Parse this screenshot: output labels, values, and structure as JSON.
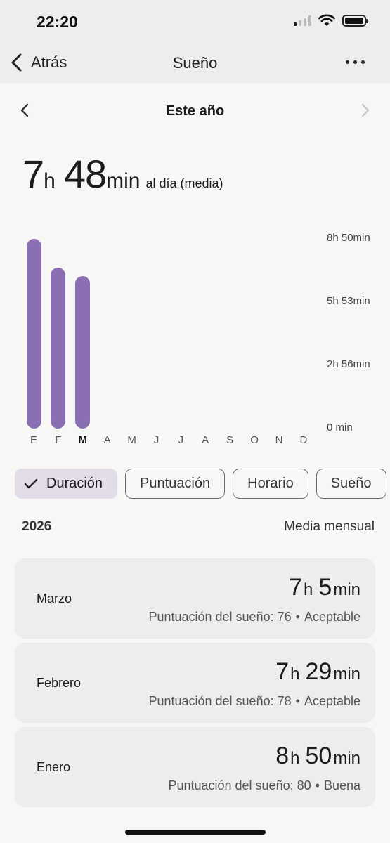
{
  "status_bar": {
    "time": "22:20"
  },
  "header": {
    "back_label": "Atrás",
    "title": "Sueño"
  },
  "period": {
    "label": "Este año"
  },
  "average": {
    "hours": "7",
    "hours_unit": "h",
    "minutes": "48",
    "minutes_unit": "min",
    "suffix": "al día (media)"
  },
  "chart_data": {
    "type": "bar",
    "categories": [
      "E",
      "F",
      "M",
      "A",
      "M",
      "J",
      "J",
      "A",
      "S",
      "O",
      "N",
      "D"
    ],
    "values": [
      530,
      449,
      425,
      null,
      null,
      null,
      null,
      null,
      null,
      null,
      null,
      null
    ],
    "value_unit": "min",
    "ytick_labels": [
      "8h 50min",
      "5h 53min",
      "2h 56min",
      "0 min"
    ],
    "ytick_values": [
      530,
      353,
      176,
      0
    ],
    "ylim": [
      0,
      530
    ],
    "active_category_index": 2,
    "bar_color": "#8a6fb2",
    "grid": false
  },
  "chips": [
    {
      "label": "Duración",
      "selected": true
    },
    {
      "label": "Puntuación",
      "selected": false
    },
    {
      "label": "Horario",
      "selected": false
    },
    {
      "label": "Sueño",
      "selected": false
    }
  ],
  "summary": {
    "year": "2026",
    "caption": "Media mensual"
  },
  "months": [
    {
      "name": "Marzo",
      "hours": "7",
      "minutes": "5",
      "score_label": "Puntuación del sueño: 76",
      "rating": "Aceptable"
    },
    {
      "name": "Febrero",
      "hours": "7",
      "minutes": "29",
      "score_label": "Puntuación del sueño: 78",
      "rating": "Aceptable"
    },
    {
      "name": "Enero",
      "hours": "8",
      "minutes": "50",
      "score_label": "Puntuación del sueño: 80",
      "rating": "Buena"
    }
  ],
  "units": {
    "h": "h",
    "min": "min"
  },
  "colors": {
    "accent": "#8a6fb2",
    "chip_selected_bg": "#e3dde9",
    "card_bg": "#ededec"
  },
  "icons": {
    "back": "chevron-left-icon",
    "more": "more-horizontal-icon",
    "check": "check-icon"
  }
}
